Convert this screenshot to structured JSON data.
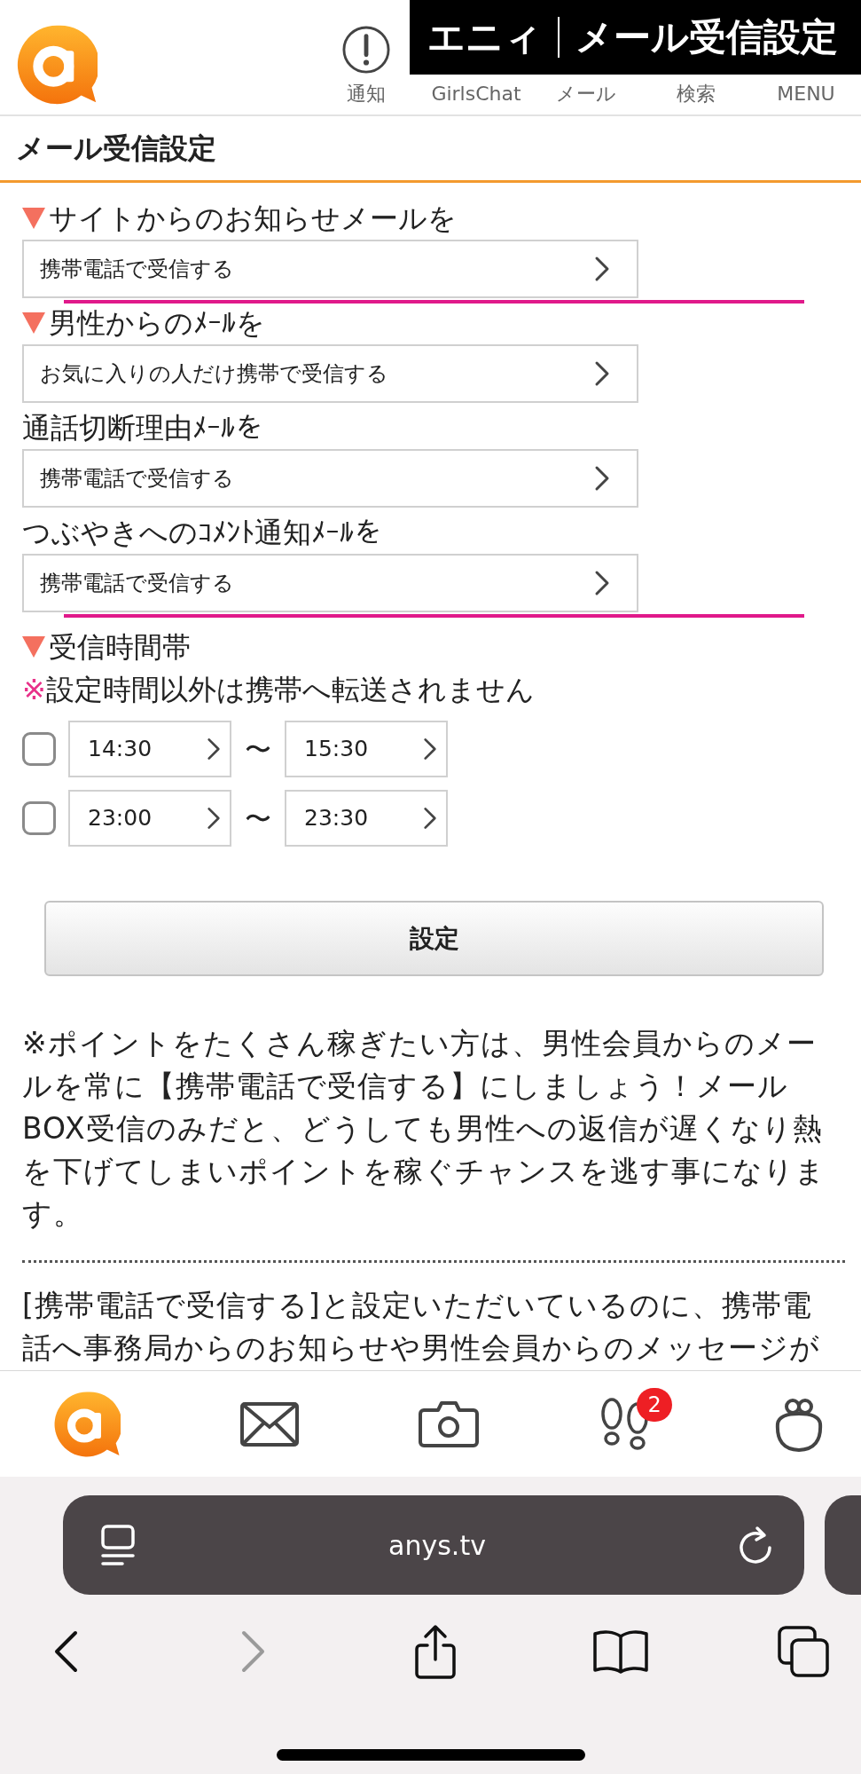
{
  "caption": {
    "brand": "エニィ",
    "title": "メール受信設定"
  },
  "header": {
    "nav": [
      {
        "label": "通知",
        "kind": "alert"
      },
      {
        "label": "GirlsChat",
        "kind": "covered"
      },
      {
        "label": "メール",
        "kind": "covered"
      },
      {
        "label": "検索",
        "kind": "covered"
      },
      {
        "label": "MENU",
        "kind": "covered"
      }
    ]
  },
  "page_title": "メール受信設定",
  "settings": [
    {
      "label": "サイトからのお知らせメールを",
      "marked": true,
      "value": "携帯電話で受信する",
      "highlighted": true
    },
    {
      "label": "男性からのﾒｰﾙを",
      "marked": true,
      "value": "お気に入りの人だけ携帯で受信する",
      "highlighted": false
    },
    {
      "label": "通話切断理由ﾒｰﾙを",
      "marked": false,
      "value": "携帯電話で受信する",
      "highlighted": false
    },
    {
      "label": "つぶやきへのｺﾒﾝﾄ通知ﾒｰﾙを",
      "marked": false,
      "value": "携帯電話で受信する",
      "highlighted": true
    }
  ],
  "time_band": {
    "label": "受信時間帯",
    "marked": true,
    "note_mark": "※",
    "note": "設定時間以外は携帯へ転送されません",
    "ranges": [
      {
        "checked": false,
        "from": "14:30",
        "separator": "〜",
        "to": "15:30"
      },
      {
        "checked": false,
        "from": "23:00",
        "separator": "〜",
        "to": "23:30"
      }
    ]
  },
  "submit_button": "設定",
  "paragraphs": [
    "※ポイントをたくさん稼ぎたい方は、男性会員からのメールを常に【携帯電話で受信する】にしましょう！メールBOX受信のみだと、どうしても男性への返信が遅くなり熱を下げてしまいポイントを稼ぐチャンスを逃す事になります。",
    "[携帯電話で受信する]と設定いただいているのに、携帯電話へ事務局からのお知らせや男性会員からのメッセージが"
  ],
  "tab_bar": {
    "badge": "2"
  },
  "browser": {
    "url": "anys.tv",
    "forward_disabled": true
  }
}
